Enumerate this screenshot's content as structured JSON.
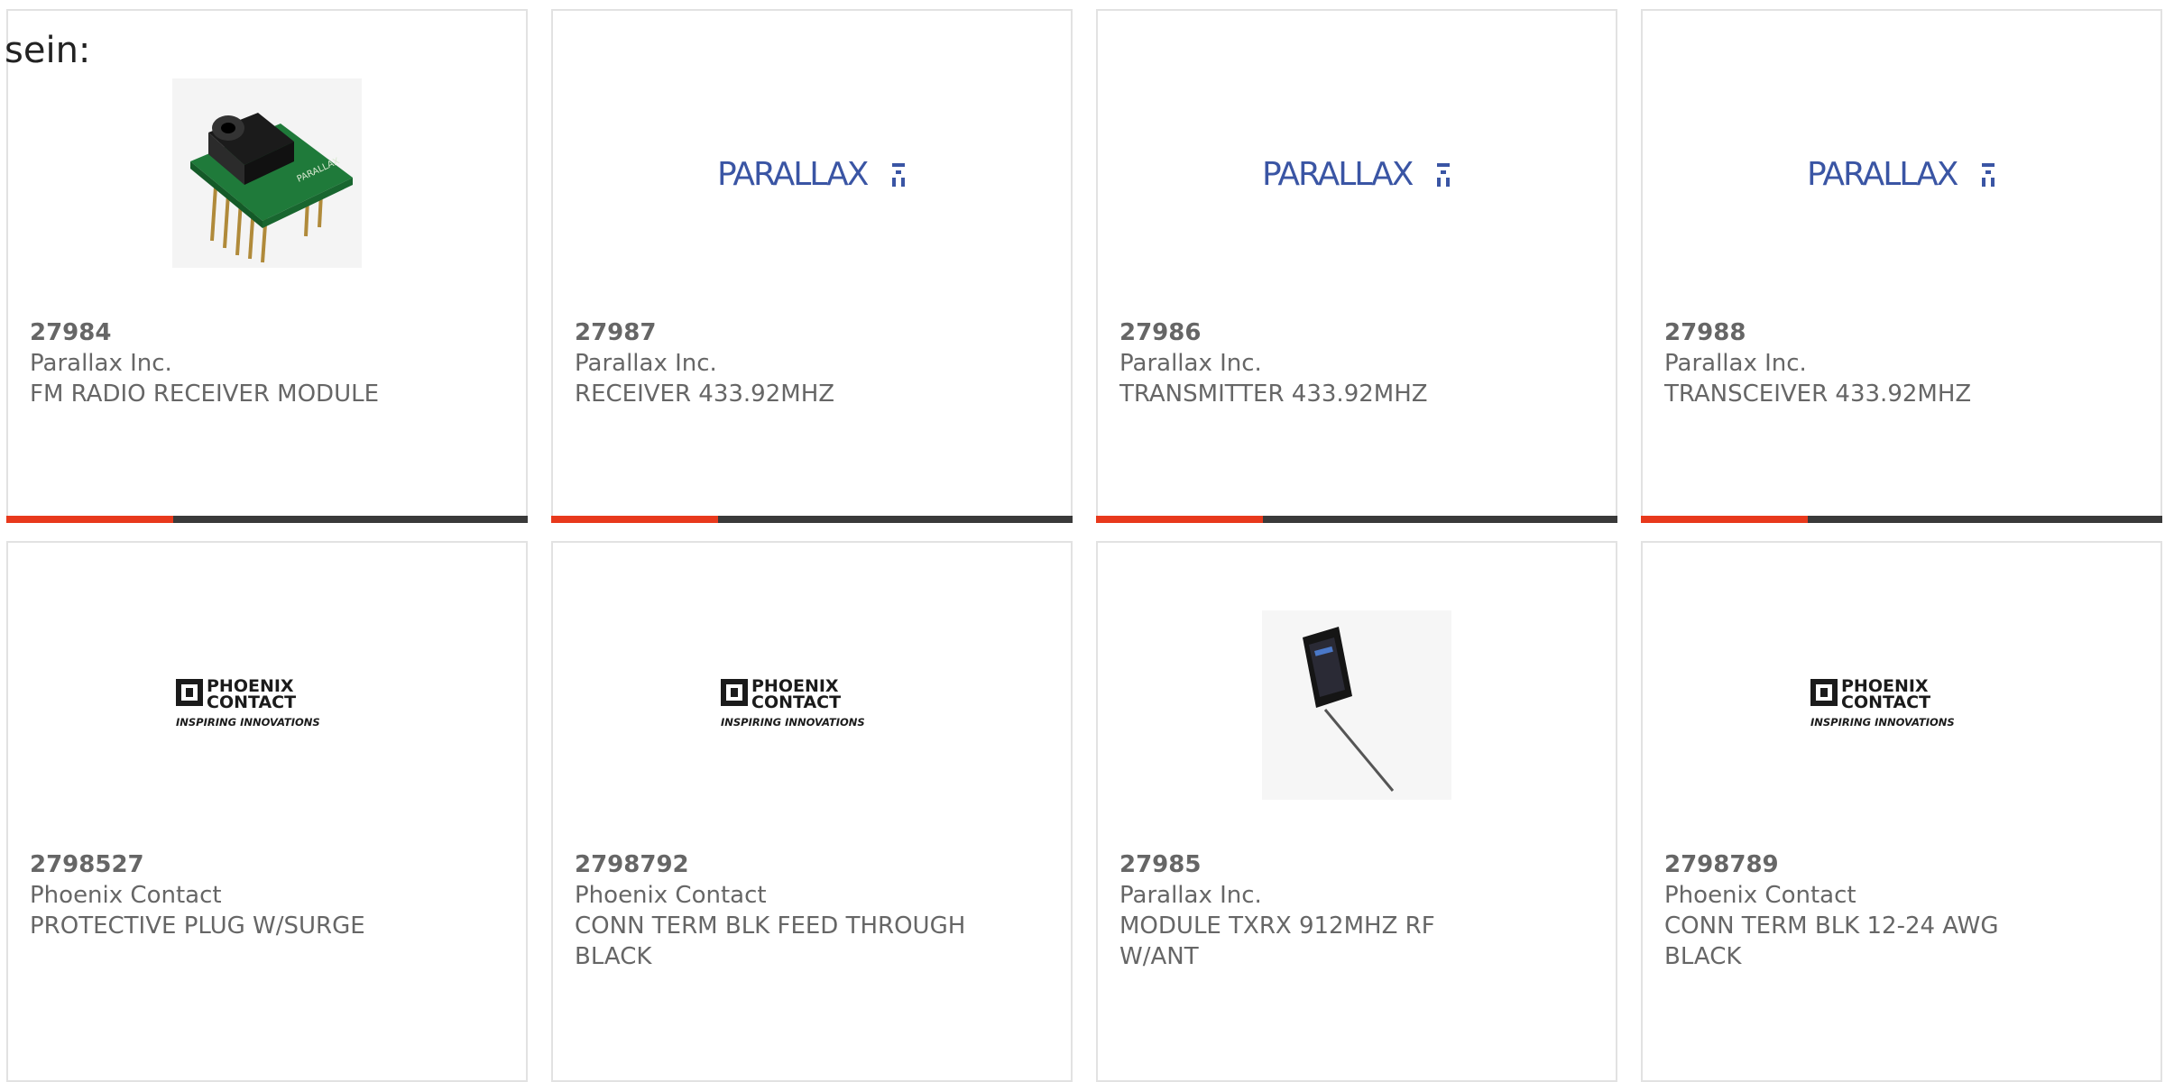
{
  "intro_text": "sein:",
  "colors": {
    "accent": "#e8391c",
    "bar_dark": "#3a3a3a",
    "text": "#666666",
    "parallax_blue": "#3a55a4"
  },
  "products": [
    {
      "part": "27984",
      "maker": "Parallax Inc.",
      "desc": "FM RADIO RECEIVER MODULE",
      "image": "jack-module-photo"
    },
    {
      "part": "27987",
      "maker": "Parallax Inc.",
      "desc": "RECEIVER 433.92MHZ",
      "image": "parallax-logo",
      "logo_text": "PARALLAX"
    },
    {
      "part": "27986",
      "maker": "Parallax Inc.",
      "desc": "TRANSMITTER 433.92MHZ",
      "image": "parallax-logo",
      "logo_text": "PARALLAX"
    },
    {
      "part": "27988",
      "maker": "Parallax Inc.",
      "desc": "TRANSCEIVER 433.92MHZ",
      "image": "parallax-logo",
      "logo_text": "PARALLAX"
    },
    {
      "part": "2798527",
      "maker": "Phoenix Contact",
      "desc": "PROTECTIVE PLUG W/SURGE",
      "image": "phoenix-logo",
      "logo_line1": "PHOENIX",
      "logo_line2": "CONTACT",
      "logo_tagline": "INSPIRING INNOVATIONS"
    },
    {
      "part": "2798792",
      "maker": "Phoenix Contact",
      "desc": "CONN TERM BLK FEED THROUGH BLACK",
      "image": "phoenix-logo",
      "logo_line1": "PHOENIX",
      "logo_line2": "CONTACT",
      "logo_tagline": "INSPIRING INNOVATIONS"
    },
    {
      "part": "27985",
      "maker": "Parallax Inc.",
      "desc": "MODULE TXRX 912MHZ RF W/ANT",
      "image": "rf-module-photo"
    },
    {
      "part": "2798789",
      "maker": "Phoenix Contact",
      "desc": "CONN TERM BLK 12-24 AWG BLACK",
      "image": "phoenix-logo",
      "logo_line1": "PHOENIX",
      "logo_line2": "CONTACT",
      "logo_tagline": "INSPIRING INNOVATIONS"
    }
  ]
}
